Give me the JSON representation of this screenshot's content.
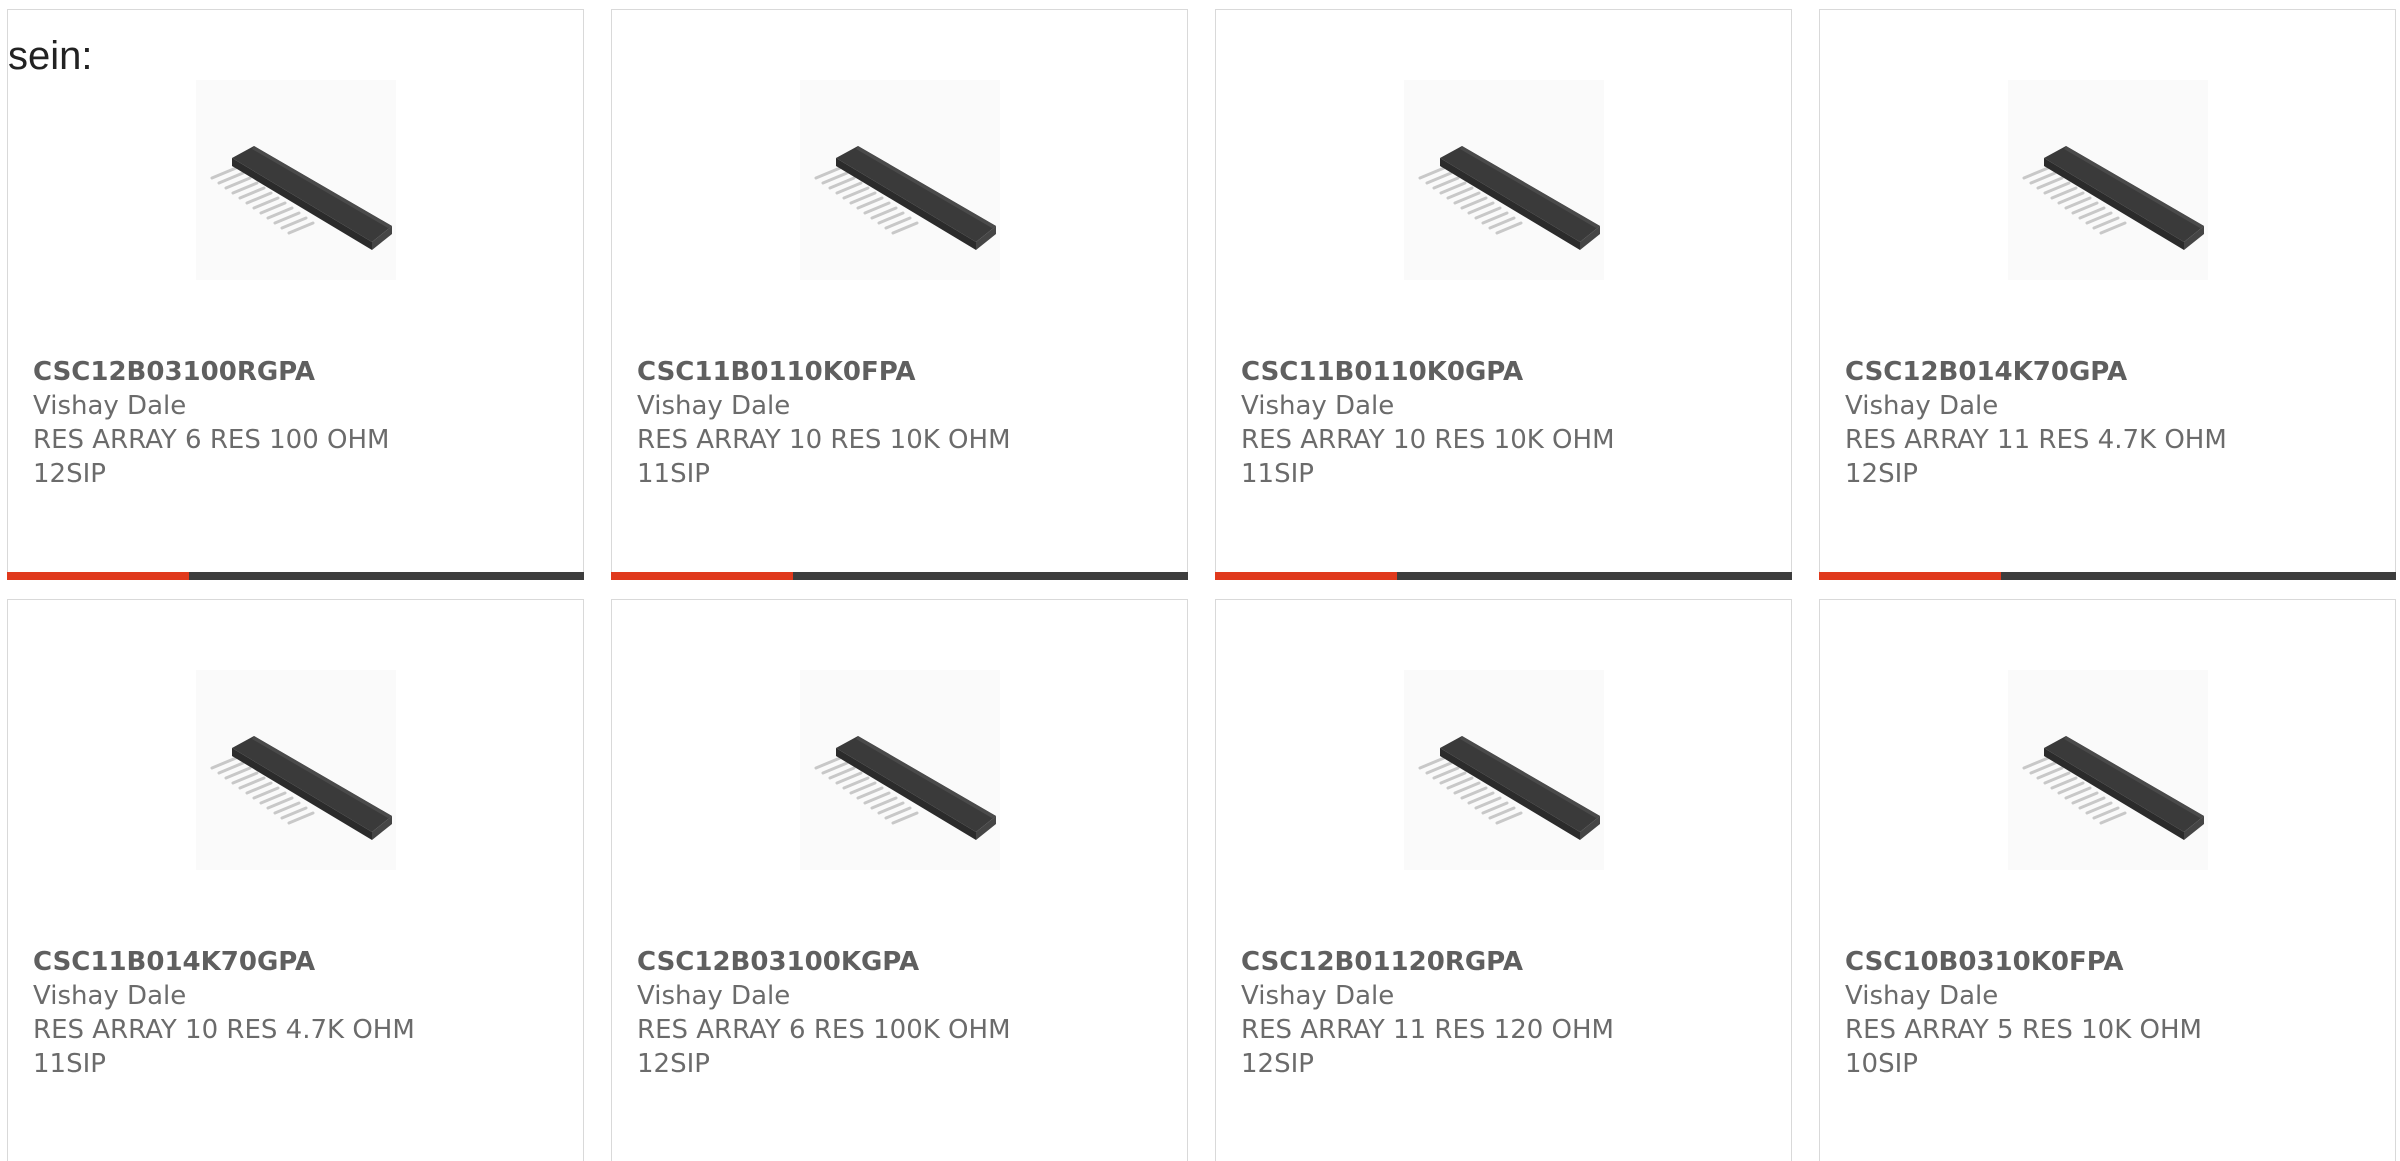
{
  "intro_text": "sein:",
  "colors": {
    "accent": "#e0391c",
    "bar": "#3d3d3d",
    "text": "#6b6b6b",
    "border": "#d9d9d9"
  },
  "products": [
    {
      "part_number": "CSC12B03100RGPA",
      "manufacturer": "Vishay Dale",
      "description": "RES ARRAY 6 RES 100 OHM",
      "package": "12SIP",
      "image_icon": "sip-chip-image"
    },
    {
      "part_number": "CSC11B0110K0FPA",
      "manufacturer": "Vishay Dale",
      "description": "RES ARRAY 10 RES 10K OHM",
      "package": "11SIP",
      "image_icon": "sip-chip-image"
    },
    {
      "part_number": "CSC11B0110K0GPA",
      "manufacturer": "Vishay Dale",
      "description": "RES ARRAY 10 RES 10K OHM",
      "package": "11SIP",
      "image_icon": "sip-chip-image"
    },
    {
      "part_number": "CSC12B014K70GPA",
      "manufacturer": "Vishay Dale",
      "description": "RES ARRAY 11 RES 4.7K OHM",
      "package": "12SIP",
      "image_icon": "sip-chip-image"
    },
    {
      "part_number": "CSC11B014K70GPA",
      "manufacturer": "Vishay Dale",
      "description": "RES ARRAY 10 RES 4.7K OHM",
      "package": "11SIP",
      "image_icon": "sip-chip-image"
    },
    {
      "part_number": "CSC12B03100KGPA",
      "manufacturer": "Vishay Dale",
      "description": "RES ARRAY 6 RES 100K OHM",
      "package": "12SIP",
      "image_icon": "sip-chip-image"
    },
    {
      "part_number": "CSC12B01120RGPA",
      "manufacturer": "Vishay Dale",
      "description": "RES ARRAY 11 RES 120 OHM",
      "package": "12SIP",
      "image_icon": "sip-chip-image"
    },
    {
      "part_number": "CSC10B0310K0FPA",
      "manufacturer": "Vishay Dale",
      "description": "RES ARRAY 5 RES 10K OHM",
      "package": "10SIP",
      "image_icon": "sip-chip-image"
    }
  ]
}
